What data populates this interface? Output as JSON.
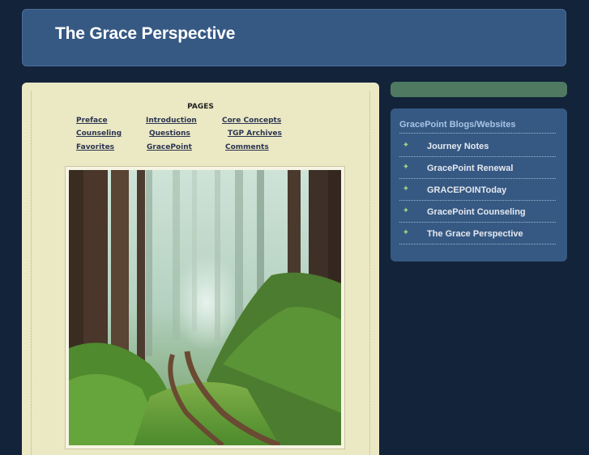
{
  "header": {
    "title": "The Grace Perspective"
  },
  "pages": {
    "heading": "PAGES",
    "row1": [
      "Preface",
      "Introduction",
      "Core Concepts"
    ],
    "row2": [
      "Counseling",
      "Questions",
      "TGP Archives"
    ],
    "row3": [
      "Favorites",
      "GracePoint",
      "Comments"
    ]
  },
  "photo": {
    "subject": "forest-path-image"
  },
  "sidebar": {
    "title": "GracePoint Blogs/Websites",
    "items": [
      {
        "label": "Journey Notes"
      },
      {
        "label": "GracePoint Renewal"
      },
      {
        "label": "GRACEPOINToday"
      },
      {
        "label": "GracePoint Counseling"
      },
      {
        "label": "The Grace Perspective"
      }
    ]
  },
  "colors": {
    "background": "#13233a",
    "panel_blue": "#365983",
    "content_bg": "#ebe8c4",
    "accent_green": "#4f7a61",
    "link_green": "#9fd27a"
  }
}
